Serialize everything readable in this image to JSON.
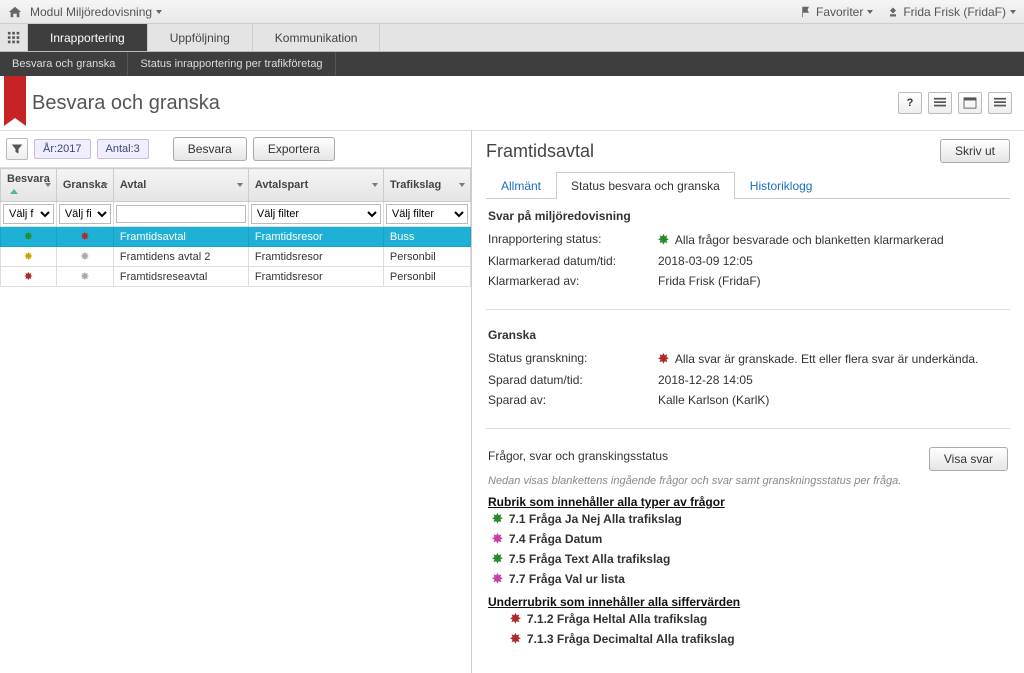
{
  "topbar": {
    "module_label": "Modul Miljöredovisning",
    "favorites_label": "Favoriter",
    "user_label": "Frida Frisk (FridaF)"
  },
  "maintabs": {
    "items": [
      {
        "label": "Inrapportering",
        "active": true
      },
      {
        "label": "Uppföljning",
        "active": false
      },
      {
        "label": "Kommunikation",
        "active": false
      }
    ]
  },
  "subtabs": {
    "items": [
      {
        "label": "Besvara och granska"
      },
      {
        "label": "Status inrapportering per trafikföretag"
      }
    ]
  },
  "page": {
    "title": "Besvara och granska"
  },
  "filterbar": {
    "year": "År:2017",
    "count": "Antal:3",
    "btn_besvara": "Besvara",
    "btn_exportera": "Exportera"
  },
  "grid": {
    "headers": {
      "besvara": "Besvara",
      "granska": "Granska",
      "avtal": "Avtal",
      "avtalspart": "Avtalspart",
      "trafikslag": "Trafikslag"
    },
    "filter_placeholders": {
      "valj": "Välj f",
      "valj2": "Välj fi",
      "valjfilter": "Välj filter"
    },
    "rows": [
      {
        "besvara": "green",
        "granska": "red",
        "avtal": "Framtidsavtal",
        "avtalspart": "Framtidsresor",
        "trafikslag": "Buss",
        "selected": true
      },
      {
        "besvara": "gold",
        "granska": "grey",
        "avtal": "Framtidens avtal 2",
        "avtalspart": "Framtidsresor",
        "trafikslag": "Personbil",
        "selected": false
      },
      {
        "besvara": "red",
        "granska": "grey",
        "avtal": "Framtidsreseavtal",
        "avtalspart": "Framtidsresor",
        "trafikslag": "Personbil",
        "selected": false
      }
    ]
  },
  "right": {
    "title": "Framtidsavtal",
    "btn_print": "Skriv ut",
    "tabs": {
      "allmant": "Allmänt",
      "status": "Status besvara och granska",
      "historik": "Historiklogg"
    },
    "svar_section": {
      "heading": "Svar på miljöredovisning",
      "k1": "Inrapportering status:",
      "v1": "Alla frågor besvarade och blanketten klarmarkerad",
      "k2": "Klarmarkerad datum/tid:",
      "v2": "2018-03-09 12:05",
      "k3": "Klarmarkerad av:",
      "v3": "Frida Frisk (FridaF)"
    },
    "granska_section": {
      "heading": "Granska",
      "k1": "Status granskning:",
      "v1": "Alla svar är granskade. Ett eller flera svar är underkända.",
      "k2": "Sparad datum/tid:",
      "v2": "2018-12-28 14:05",
      "k3": "Sparad av:",
      "v3": "Kalle Karlson (KarlK)"
    },
    "questions": {
      "heading": "Frågor, svar och granskingsstatus",
      "btn_show": "Visa svar",
      "hint": "Nedan visas blankettens ingående frågor och svar samt granskningsstatus per fråga.",
      "rubrik1": "Rubrik som innehåller alla typer av frågor",
      "q1": "7.1 Fråga Ja Nej Alla trafikslag",
      "q2": "7.4 Fråga Datum",
      "q3": "7.5 Fråga Text Alla trafikslag",
      "q4": "7.7 Fråga Val ur lista",
      "rubrik2": "Underrubrik som innehåller alla siffervärden",
      "q5": "7.1.2 Fråga Heltal Alla trafikslag",
      "q6": "7.1.3 Fråga Decimaltal Alla trafikslag"
    }
  }
}
